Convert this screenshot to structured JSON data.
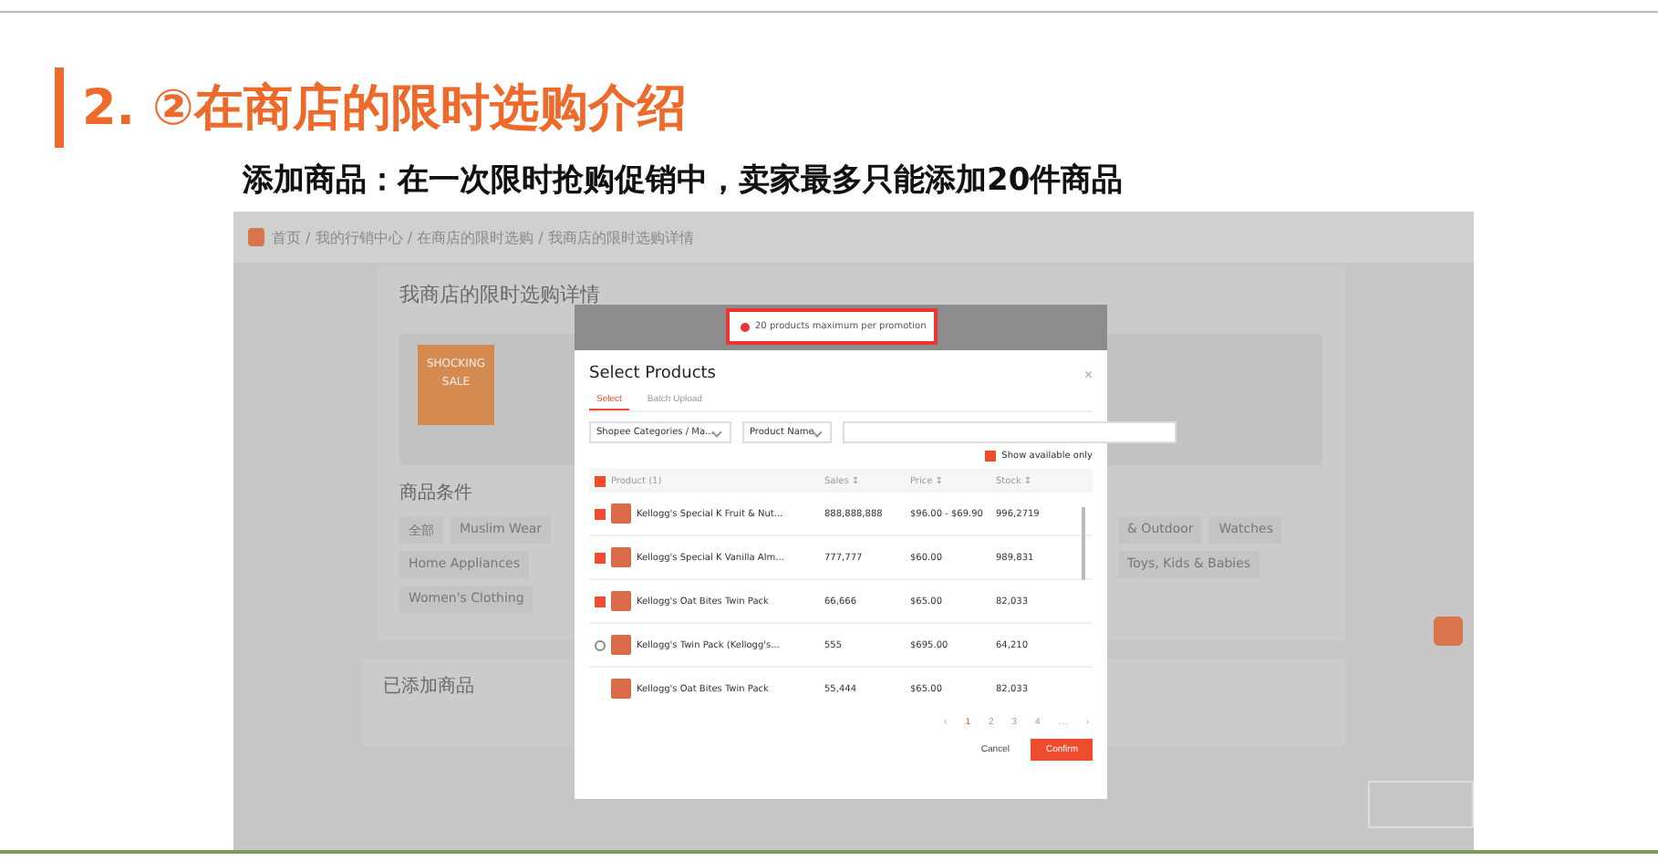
{
  "slide": {
    "title": "2. ②在商店的限时选购介绍",
    "subtitle": "添加商品：在一次限时抢购促销中，卖家最多只能添加20件商品"
  },
  "page": {
    "breadcrumb": "首页 / 我的行销中心 / 在商店的限时选购 / 我商店的限时选购详情",
    "detail_title": "我商店的限时选购详情",
    "banner": "SHOCKING SALE",
    "conditions_title": "商品条件",
    "chips_left": [
      [
        "全部",
        "Muslim Wear"
      ],
      [
        "Home Appliances"
      ],
      [
        "Women's Clothing"
      ]
    ],
    "chips_right": [
      [
        "& Outdoor",
        "Watches"
      ],
      [
        "Toys, Kids & Babies"
      ]
    ],
    "added_title": "已添加商品"
  },
  "modal": {
    "toast": "20 products maximum per promotion",
    "title": "Select Products",
    "close": "×",
    "tabs": [
      {
        "label": "Select",
        "selected": true
      },
      {
        "label": "Batch Upload",
        "selected": false
      }
    ],
    "category": "Shopee Categories / Ma...",
    "search_by": "Product Name",
    "available_only": {
      "label": "Show available only",
      "checked": true
    },
    "select_all_checked": true,
    "columns": [
      "Product (1)",
      "Sales ↕",
      "Price ↕",
      "Stock ↕"
    ],
    "rows": [
      {
        "name": "Kellogg's Special K Fruit & Nut...",
        "sales": "888,888,888",
        "price": "$96.00 - $69.90",
        "stock": "996,2719",
        "kind": "checkbox",
        "checked": true
      },
      {
        "name": "Kellogg's Special K Vanilla Alm...",
        "sales": "777,777",
        "price": "$60.00",
        "stock": "989,831",
        "kind": "checkbox",
        "checked": true
      },
      {
        "name": "Kellogg's Oat Bites Twin Pack",
        "sales": "66,666",
        "price": "$65.00",
        "stock": "82,033",
        "kind": "checkbox",
        "checked": true
      },
      {
        "name": "Kellogg's Twin Pack (Kellogg's...",
        "sales": "555",
        "price": "$695.00",
        "stock": "64,210",
        "kind": "loading"
      },
      {
        "name": "Kellogg's Oat Bites Twin Pack",
        "sales": "55,444",
        "price": "$65.00",
        "stock": "82,033",
        "kind": "checkbox",
        "checked": false
      }
    ],
    "pages": [
      {
        "label": "‹",
        "selected": false
      },
      {
        "label": "1",
        "selected": true
      },
      {
        "label": "2",
        "selected": false
      },
      {
        "label": "3",
        "selected": false
      },
      {
        "label": "4",
        "selected": false
      },
      {
        "label": "…",
        "selected": false
      },
      {
        "label": "›",
        "selected": false
      }
    ],
    "cancel": "Cancel",
    "confirm": "Confirm"
  }
}
